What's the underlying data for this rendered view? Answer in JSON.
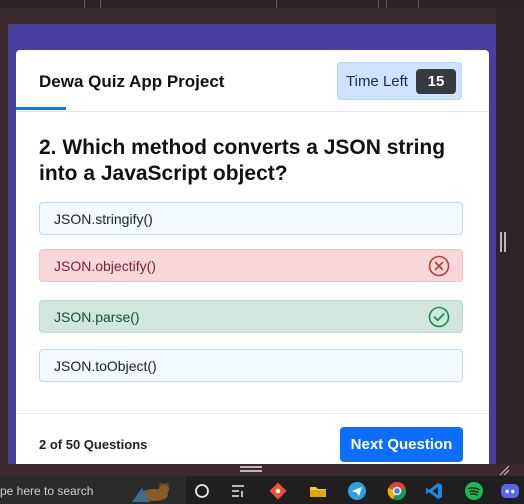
{
  "app": {
    "title": "Dewa Quiz App Project"
  },
  "timer": {
    "label": "Time Left",
    "value": "15"
  },
  "question": {
    "text": "2. Which method converts a JSON string into a JavaScript object?"
  },
  "options": [
    {
      "label": "JSON.stringify()",
      "state": "neutral"
    },
    {
      "label": "JSON.objectify()",
      "state": "wrong",
      "icon": "x-circle-icon"
    },
    {
      "label": "JSON.parse()",
      "state": "correct",
      "icon": "check-circle-icon"
    },
    {
      "label": "JSON.toObject()",
      "state": "neutral"
    }
  ],
  "footer": {
    "progress": "2 of 50 Questions",
    "next_label": "Next Question"
  },
  "taskbar": {
    "search_text": "pe here to search",
    "icons": [
      "task-view-icon",
      "widgets-icon",
      "git-icon",
      "file-explorer-icon",
      "telegram-icon",
      "chrome-icon",
      "vscode-icon",
      "spotify-icon",
      "discord-icon"
    ]
  },
  "colors": {
    "accent": "#1a73e8",
    "button": "#0d6efd",
    "wrong_bg": "#f8d7da",
    "correct_bg": "#d1e7dd",
    "neutral_bg": "#f2f9ff",
    "timer_bg": "#cfe2ff"
  }
}
